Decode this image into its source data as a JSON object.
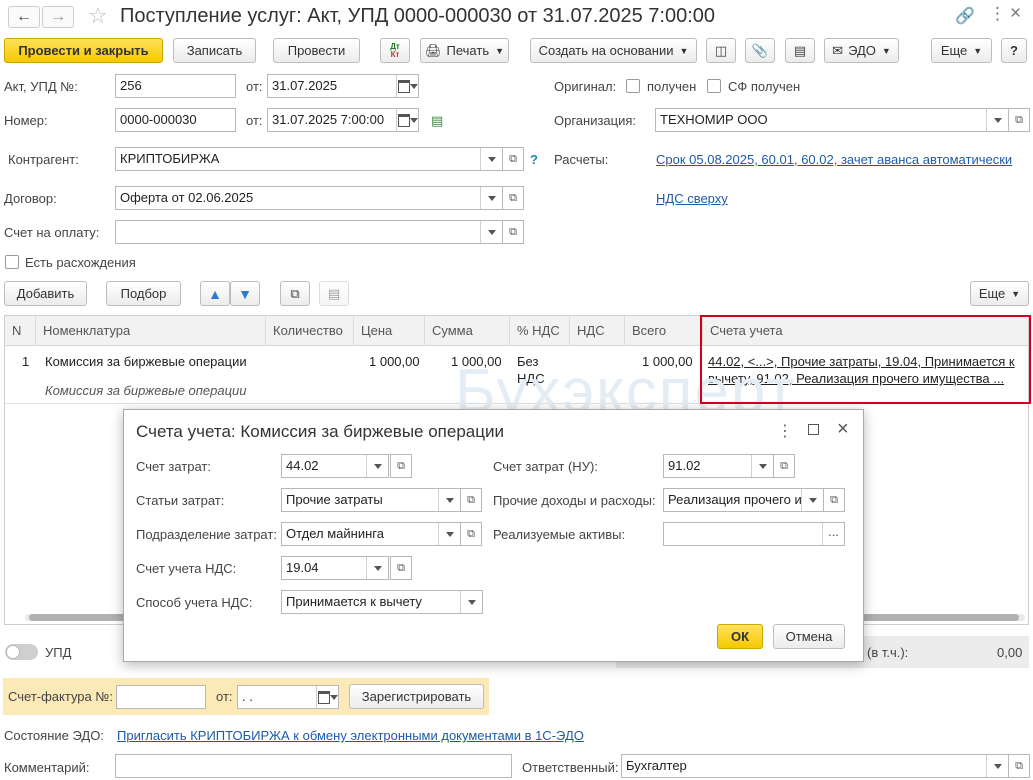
{
  "window": {
    "title": "Поступление услуг: Акт, УПД 0000-000030 от 31.07.2025 7:00:00"
  },
  "toolbar": {
    "post_close": "Провести и закрыть",
    "save": "Записать",
    "post": "Провести",
    "dtkt_top": "Дт",
    "dtkt_bottom": "Кт",
    "print": "Печать",
    "create_based": "Создать на основании",
    "edo": "ЭДО",
    "more": "Еще",
    "help": "?"
  },
  "header": {
    "act_label": "Акт, УПД №:",
    "act_value": "256",
    "from_label": "от:",
    "act_date": "31.07.2025",
    "number_label": "Номер:",
    "number_value": "0000-000030",
    "number_date": "31.07.2025  7:00:00",
    "original_label": "Оригинал:",
    "received": "получен",
    "sf_received": "СФ получен",
    "org_label": "Организация:",
    "org_value": "ТЕХНОМИР ООО",
    "contractor_label": "Контрагент:",
    "contractor_value": "КРИПТОБИРЖА",
    "question": "?",
    "payments_label": "Расчеты:",
    "payments_link": "Срок 05.08.2025, 60.01, 60.02, зачет аванса автоматически",
    "contract_label": "Договор:",
    "contract_value": "Оферта от 02.06.2025",
    "vat_link": "НДС сверху",
    "invoice_label": "Счет на оплату:",
    "invoice_value": "",
    "discrepancy_label": "Есть расхождения"
  },
  "table_toolbar": {
    "add": "Добавить",
    "select": "Подбор",
    "more": "Еще"
  },
  "table": {
    "columns": [
      "N",
      "Номенклатура",
      "Количество",
      "Цена",
      "Сумма",
      "% НДС",
      "НДС",
      "Всего",
      "Счета учета"
    ],
    "rows": [
      {
        "n": "1",
        "item": "Комиссия за биржевые операции",
        "item_sub": "Комиссия за биржевые операции",
        "qty": "",
        "price": "1 000,00",
        "sum": "1 000,00",
        "vat_rate_1": "Без",
        "vat_rate_2": "НДС",
        "vat": "",
        "total": "1 000,00",
        "accounts_1": "44.02, <...>, Прочие затраты, 19.04, Принимается к",
        "accounts_2": "вычету, 91.02, Реализация прочего имущества ..."
      }
    ]
  },
  "watermark": "Бухэксперт",
  "footer": {
    "upd_label": "УПД",
    "totals_label": "(в т.ч.):",
    "totals_value": "0,00",
    "invoice_label": "Счет-фактура №:",
    "invoice_number": "",
    "from_label": "от:",
    "invoice_date": " .  .",
    "register": "Зарегистрировать",
    "edo_state_label": "Состояние ЭДО:",
    "edo_link": "Пригласить КРИПТОБИРЖА к обмену электронными документами в 1С-ЭДО",
    "comment_label": "Комментарий:",
    "comment_value": "",
    "responsible_label": "Ответственный:",
    "responsible_value": "Бухгалтер"
  },
  "dialog": {
    "title": "Счета учета: Комиссия за биржевые операции",
    "cost_account_label": "Счет затрат:",
    "cost_account": "44.02",
    "cost_items_label": "Статьи затрат:",
    "cost_items": "Прочие затраты",
    "cost_dept_label": "Подразделение затрат:",
    "cost_dept": "Отдел майнинга",
    "vat_account_label": "Счет учета НДС:",
    "vat_account": "19.04",
    "vat_method_label": "Способ учета НДС:",
    "vat_method": "Принимается к вычету",
    "cost_account_nu_label": "Счет затрат (НУ):",
    "cost_account_nu": "91.02",
    "other_income_label": "Прочие доходы и расходы:",
    "other_income": "Реализация прочего и",
    "assets_label": "Реализуемые активы:",
    "assets": "",
    "ok": "ОК",
    "cancel": "Отмена"
  },
  "colors": {
    "accent_yellow": "#f5c900",
    "highlight_red": "#d0021b",
    "link_blue": "#1f5aa6",
    "invoice_bg": "#fbe9b7"
  }
}
